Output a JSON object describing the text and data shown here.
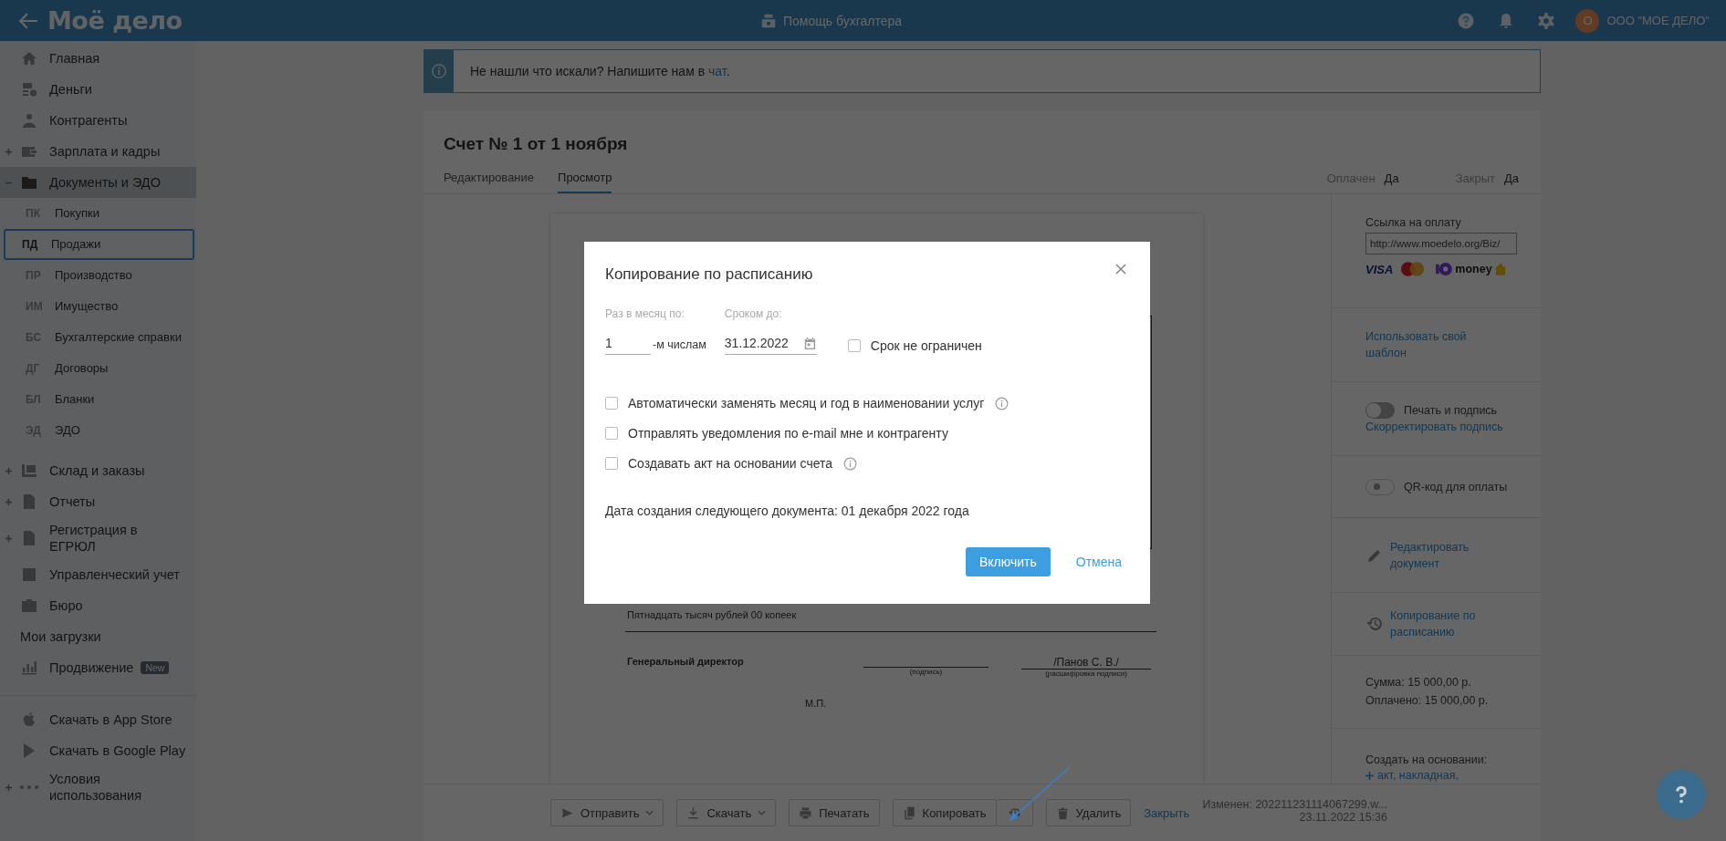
{
  "topbar": {
    "logo": "Моё дело",
    "help_link": "Помощь бухгалтера",
    "avatar": "О",
    "company": "ООО \"МОЕ ДЕЛО\""
  },
  "sidebar": {
    "items": [
      {
        "kind": "section",
        "label": "Главная",
        "selected": false
      },
      {
        "kind": "section",
        "label": "Деньги",
        "selected": false
      },
      {
        "kind": "section",
        "label": "Контрагенты",
        "selected": false
      },
      {
        "kind": "section",
        "label": "Зарплата и кадры",
        "selected": false,
        "expanded": false
      },
      {
        "kind": "section",
        "label": "Документы и ЭДО",
        "selected": true,
        "expanded": true
      },
      {
        "kind": "sub",
        "abbr": "ПК",
        "label": "Покупки",
        "selected": false
      },
      {
        "kind": "sub",
        "abbr": "ПД",
        "label": "Продажи",
        "selected": true
      },
      {
        "kind": "sub",
        "abbr": "ПР",
        "label": "Производство",
        "selected": false
      },
      {
        "kind": "sub",
        "abbr": "ИМ",
        "label": "Имущество",
        "selected": false
      },
      {
        "kind": "sub",
        "abbr": "БС",
        "label": "Бухгалтерские справки",
        "selected": false
      },
      {
        "kind": "sub",
        "abbr": "ДГ",
        "label": "Договоры",
        "selected": false
      },
      {
        "kind": "sub",
        "abbr": "БЛ",
        "label": "Бланки",
        "selected": false
      },
      {
        "kind": "sub",
        "abbr": "ЭД",
        "label": "ЭДО",
        "selected": false
      },
      {
        "kind": "section",
        "label": "Склад и заказы",
        "selected": false,
        "expanded": false
      },
      {
        "kind": "section",
        "label": "Отчеты",
        "selected": false,
        "expanded": false
      },
      {
        "kind": "section",
        "label": "Регистрация в\nЕГРЮЛ",
        "selected": false,
        "expanded": false
      },
      {
        "kind": "section",
        "label": "Управленческий учет",
        "selected": false
      },
      {
        "kind": "section",
        "label": "Бюро",
        "selected": false
      },
      {
        "kind": "plain",
        "label": "Мои загрузки",
        "selected": false
      },
      {
        "kind": "section",
        "label": "Продвижение",
        "badge": "New",
        "selected": false
      }
    ],
    "footer_items": [
      {
        "label": "Скачать в App Store"
      },
      {
        "label": "Скачать в Google Play"
      },
      {
        "label": "Условия\nиспользования",
        "expanded": false
      }
    ]
  },
  "banner": {
    "text": "Не нашли что искали? Напишите нам в ",
    "link": "чат",
    "after": "."
  },
  "document": {
    "title": "Счет № 1 от 1 ноября",
    "tabs": [
      {
        "label": "Редактирование",
        "selected": false
      },
      {
        "label": "Просмотр",
        "selected": true
      }
    ],
    "statuses": [
      {
        "label": "Оплачен",
        "value": "Да"
      },
      {
        "label": "Закрыт",
        "value": "Да"
      }
    ],
    "amount_words": "Пятнадцать тысяч рублей 00 копеек",
    "signer": "Генеральный директор",
    "signature_caption": "(подпись)",
    "signer_name": "/Панов С. В./",
    "name_caption": "(расшифровка подписи)",
    "stamp": "М.П."
  },
  "side_panel": {
    "payment_label": "Ссылка на оплату",
    "payment_url": "http://www.moedelo.org/Biz/",
    "visa": "VISA",
    "yoomoney": "money",
    "template_link": "Использовать свой шаблон",
    "toggles": [
      {
        "label": "Печать и подпись",
        "on": false,
        "disabled": false,
        "link": "Скорректировать подпись"
      },
      {
        "label": "QR-код для оплаты",
        "on": false,
        "disabled": true
      }
    ],
    "actions": [
      {
        "kind": "edit",
        "label": "Редактировать документ"
      },
      {
        "kind": "schedule",
        "label": "Копирование по расписанию"
      }
    ],
    "sum": "Сумма: 15 000,00 р.",
    "paid": "Оплачено: 15 000,00 р.",
    "create_label": "Создать на основании:",
    "create_links": "акт, накладная,"
  },
  "footer": {
    "buttons": [
      {
        "kind": "dropdown",
        "label": "Отправить"
      },
      {
        "kind": "dropdown",
        "label": "Скачать"
      },
      {
        "kind": "plain",
        "label": "Печатать"
      },
      {
        "kind": "split",
        "label": "Копировать"
      },
      {
        "kind": "plain",
        "label": "Удалить"
      },
      {
        "kind": "link",
        "label": "Закрыть"
      }
    ],
    "modified": "Изменен: 202211231114067299.w...",
    "modified_date": "23.11.2022 15:36"
  },
  "modal": {
    "title": "Копирование по расписанию",
    "day_label": "Раз в месяц по:",
    "day_value": "1",
    "day_suffix": "-м числам",
    "until_label": "Сроком до:",
    "until_value": "31.12.2022",
    "unlimited": {
      "label": "Срок не ограничен",
      "checked": false
    },
    "options": [
      {
        "label": "Автоматически заменять месяц и год в наименовании услуг",
        "checked": false,
        "info": true
      },
      {
        "label": "Отправлять уведомления по e-mail мне и контрагенту",
        "checked": false,
        "info": false
      },
      {
        "label": "Создавать акт на основании счета",
        "checked": false,
        "info": true
      }
    ],
    "next_date": "Дата создания следующего документа: 01 декабря 2022 года",
    "confirm": "Включить",
    "cancel": "Отмена"
  }
}
